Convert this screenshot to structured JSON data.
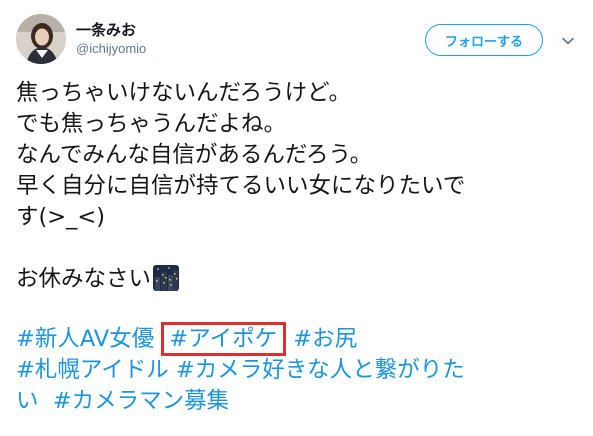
{
  "user": {
    "display_name": "一条みお",
    "handle": "@ichijyomio"
  },
  "follow_button": {
    "label": "フォローする"
  },
  "tweet": {
    "lines": [
      "焦っちゃいけないんだろうけど。",
      "でも焦っちゃうんだよね。",
      "なんでみんな自信があるんだろう。",
      "早く自分に自信が持てるいい女になりたいで",
      "す(>_<)"
    ],
    "closing": "お休みなさい",
    "closing_emoji": "night-city-emoji"
  },
  "hashtags": {
    "line1": [
      "#新人AV女優",
      "#アイポケ",
      "#お尻"
    ],
    "line2": [
      "#札幌アイドル",
      "#カメラ好きな人と繋がりた"
    ],
    "line3_prefix": "い",
    "line3": [
      "#カメラマン募集"
    ]
  },
  "colors": {
    "link": "#1b95e0",
    "follow_border": "#1da1f2",
    "highlight_box": "#e02d2d"
  },
  "icons": [
    "avatar-photo",
    "chevron-down-icon",
    "night-city-emoji"
  ]
}
